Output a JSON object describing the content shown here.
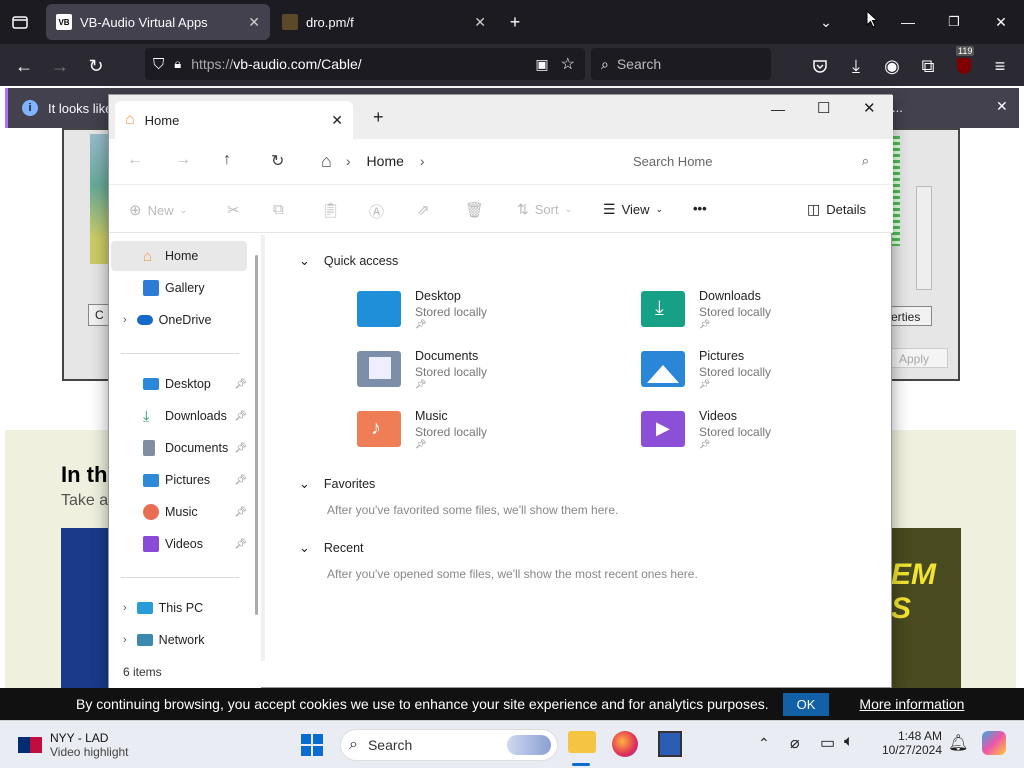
{
  "browser": {
    "tabs": [
      {
        "label": "VB-Audio Virtual Apps",
        "icon": "vb-audio-favicon"
      },
      {
        "label": "dro.pm/f",
        "icon": "folder-favicon"
      }
    ],
    "url_scheme": "https://",
    "url_rest": "vb-audio.com/Cable/",
    "search_placeholder": "Search",
    "extension_badge": "119",
    "notification_text": "It looks like",
    "notification_suffix": "..."
  },
  "explorer": {
    "tab_title": "Home",
    "breadcrumb": "Home",
    "search_placeholder": "Search Home",
    "toolbar": {
      "new_label": "New",
      "sort_label": "Sort",
      "view_label": "View",
      "more_label": "•••",
      "details_label": "Details"
    },
    "sidebar": {
      "top_items": [
        {
          "label": "Home",
          "icon": "home-icon",
          "color": "#f29b4c"
        },
        {
          "label": "Gallery",
          "icon": "gallery-icon",
          "color": "#2e7bd6"
        },
        {
          "label": "OneDrive",
          "icon": "onedrive-icon",
          "color": "#1769c9"
        }
      ],
      "pinned_items": [
        {
          "label": "Desktop",
          "icon": "desktop-icon",
          "color": "#2a8ad9"
        },
        {
          "label": "Downloads",
          "icon": "downloads-icon",
          "color": "#1a9a5c"
        },
        {
          "label": "Documents",
          "icon": "documents-icon",
          "color": "#7f8ea1"
        },
        {
          "label": "Pictures",
          "icon": "pictures-icon",
          "color": "#2d8ad8"
        },
        {
          "label": "Music",
          "icon": "music-icon",
          "color": "#e86e54"
        },
        {
          "label": "Videos",
          "icon": "videos-icon",
          "color": "#8a4ad8"
        }
      ],
      "bottom_items": [
        {
          "label": "This PC",
          "icon": "this-pc-icon",
          "color": "#2a9bd9"
        },
        {
          "label": "Network",
          "icon": "network-icon",
          "color": "#3a8ab0"
        }
      ],
      "status": "6 items"
    },
    "quick_access": {
      "title": "Quick access",
      "items": [
        {
          "name": "Desktop",
          "sub": "Stored locally",
          "icon": "desktop-folder-icon",
          "color": "#1e8fd8"
        },
        {
          "name": "Downloads",
          "sub": "Stored locally",
          "icon": "downloads-folder-icon",
          "color": "#16a085"
        },
        {
          "name": "Documents",
          "sub": "Stored locally",
          "icon": "documents-folder-icon",
          "color": "#7d8ea8"
        },
        {
          "name": "Pictures",
          "sub": "Stored locally",
          "icon": "pictures-folder-icon",
          "color": "#2a86d6"
        },
        {
          "name": "Music",
          "sub": "Stored locally",
          "icon": "music-folder-icon",
          "color": "#ef7d55"
        },
        {
          "name": "Videos",
          "sub": "Stored locally",
          "icon": "videos-folder-icon",
          "color": "#8c4fd8"
        }
      ]
    },
    "favorites": {
      "title": "Favorites",
      "note": "After you've favorited some files, we'll show them here."
    },
    "recent": {
      "title": "Recent",
      "note": "After you've opened some files, we'll show the most recent ones here."
    }
  },
  "page": {
    "heading_partial": "In the",
    "sub_partial": "Take a",
    "dialog_button_partial": "C",
    "properties_partial": "erties",
    "apply_label": "Apply",
    "banner_text_top": "EM",
    "banner_text_bottom": "S"
  },
  "cookie": {
    "text": "By continuing browsing, you accept cookies we use to enhance your site experience and for analytics purposes.",
    "ok_label": "OK",
    "more_label": "More information"
  },
  "taskbar": {
    "widget_title": "NYY - LAD",
    "widget_sub": "Video highlight",
    "search_label": "Search",
    "time": "1:48 AM",
    "date": "10/27/2024"
  }
}
